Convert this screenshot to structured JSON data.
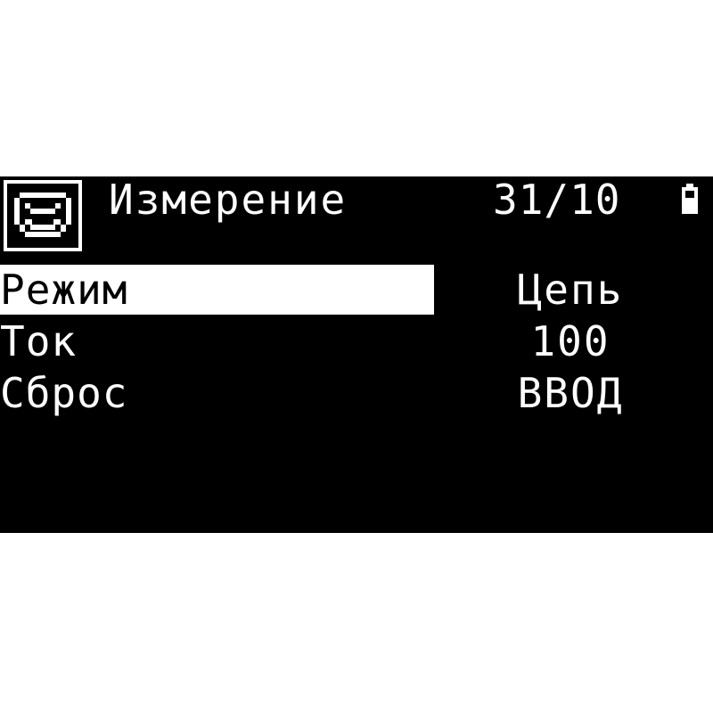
{
  "header": {
    "title": "Измерение",
    "date": "31/10",
    "icon": "device-icon",
    "battery_icon": "battery-icon"
  },
  "menu": {
    "items": [
      {
        "label": "Режим",
        "value": "Цепь",
        "selected": true
      },
      {
        "label": "Ток",
        "value": "100",
        "selected": false
      },
      {
        "label": "Сброс",
        "value": "ВВОД",
        "selected": false
      }
    ]
  },
  "colors": {
    "background": "#000000",
    "foreground": "#ffffff",
    "page": "#ffffff"
  }
}
